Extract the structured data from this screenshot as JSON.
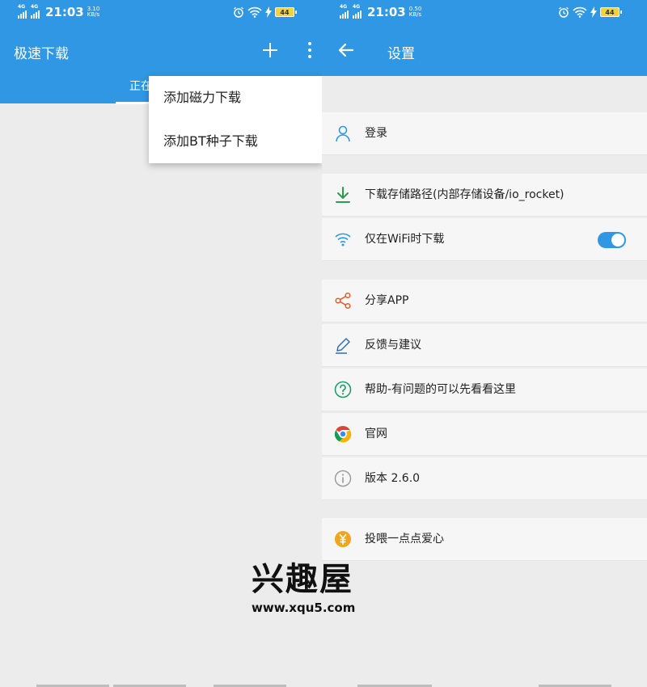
{
  "left": {
    "status": {
      "net1": "4G",
      "net2": "4G",
      "time": "21:03",
      "speed_value": "3.10",
      "speed_unit": "KB/s",
      "battery": "44"
    },
    "app_title": "极速下载",
    "tab_partial": "正在",
    "menu": {
      "items": [
        {
          "label": "添加磁力下载"
        },
        {
          "label": "添加BT种子下载"
        }
      ]
    }
  },
  "right": {
    "status": {
      "net1": "4G",
      "net2": "4G",
      "time": "21:03",
      "speed_value": "0.50",
      "speed_unit": "KB/s",
      "battery": "44"
    },
    "title": "设置",
    "rows": [
      {
        "label": "登录",
        "icon": "person-icon"
      },
      {
        "label": "下载存储路径(内部存储设备/io_rocket)",
        "icon": "download-icon"
      },
      {
        "label": "仅在WiFi时下载",
        "icon": "wifi-icon",
        "toggle": true
      },
      {
        "label": "分享APP",
        "icon": "share-icon"
      },
      {
        "label": "反馈与建议",
        "icon": "pen-icon"
      },
      {
        "label": "帮助-有问题的可以先看看这里",
        "icon": "help-icon"
      },
      {
        "label": "官网",
        "icon": "chrome-icon"
      },
      {
        "label": "版本 2.6.0",
        "icon": "info-icon"
      },
      {
        "label": "投喂一点点爱心",
        "icon": "yen-coin-icon"
      }
    ]
  },
  "watermark": {
    "logo_text": "兴趣屋",
    "url": "www.xqu5.com"
  },
  "colors": {
    "accent": "#2f97e3",
    "background": "#ececec",
    "row_bg": "#f6f6f6",
    "download_icon": "#2e9a4f",
    "share_icon": "#e65a2c",
    "help_icon": "#1e9e6a",
    "coin_icon": "#f0a51c"
  }
}
